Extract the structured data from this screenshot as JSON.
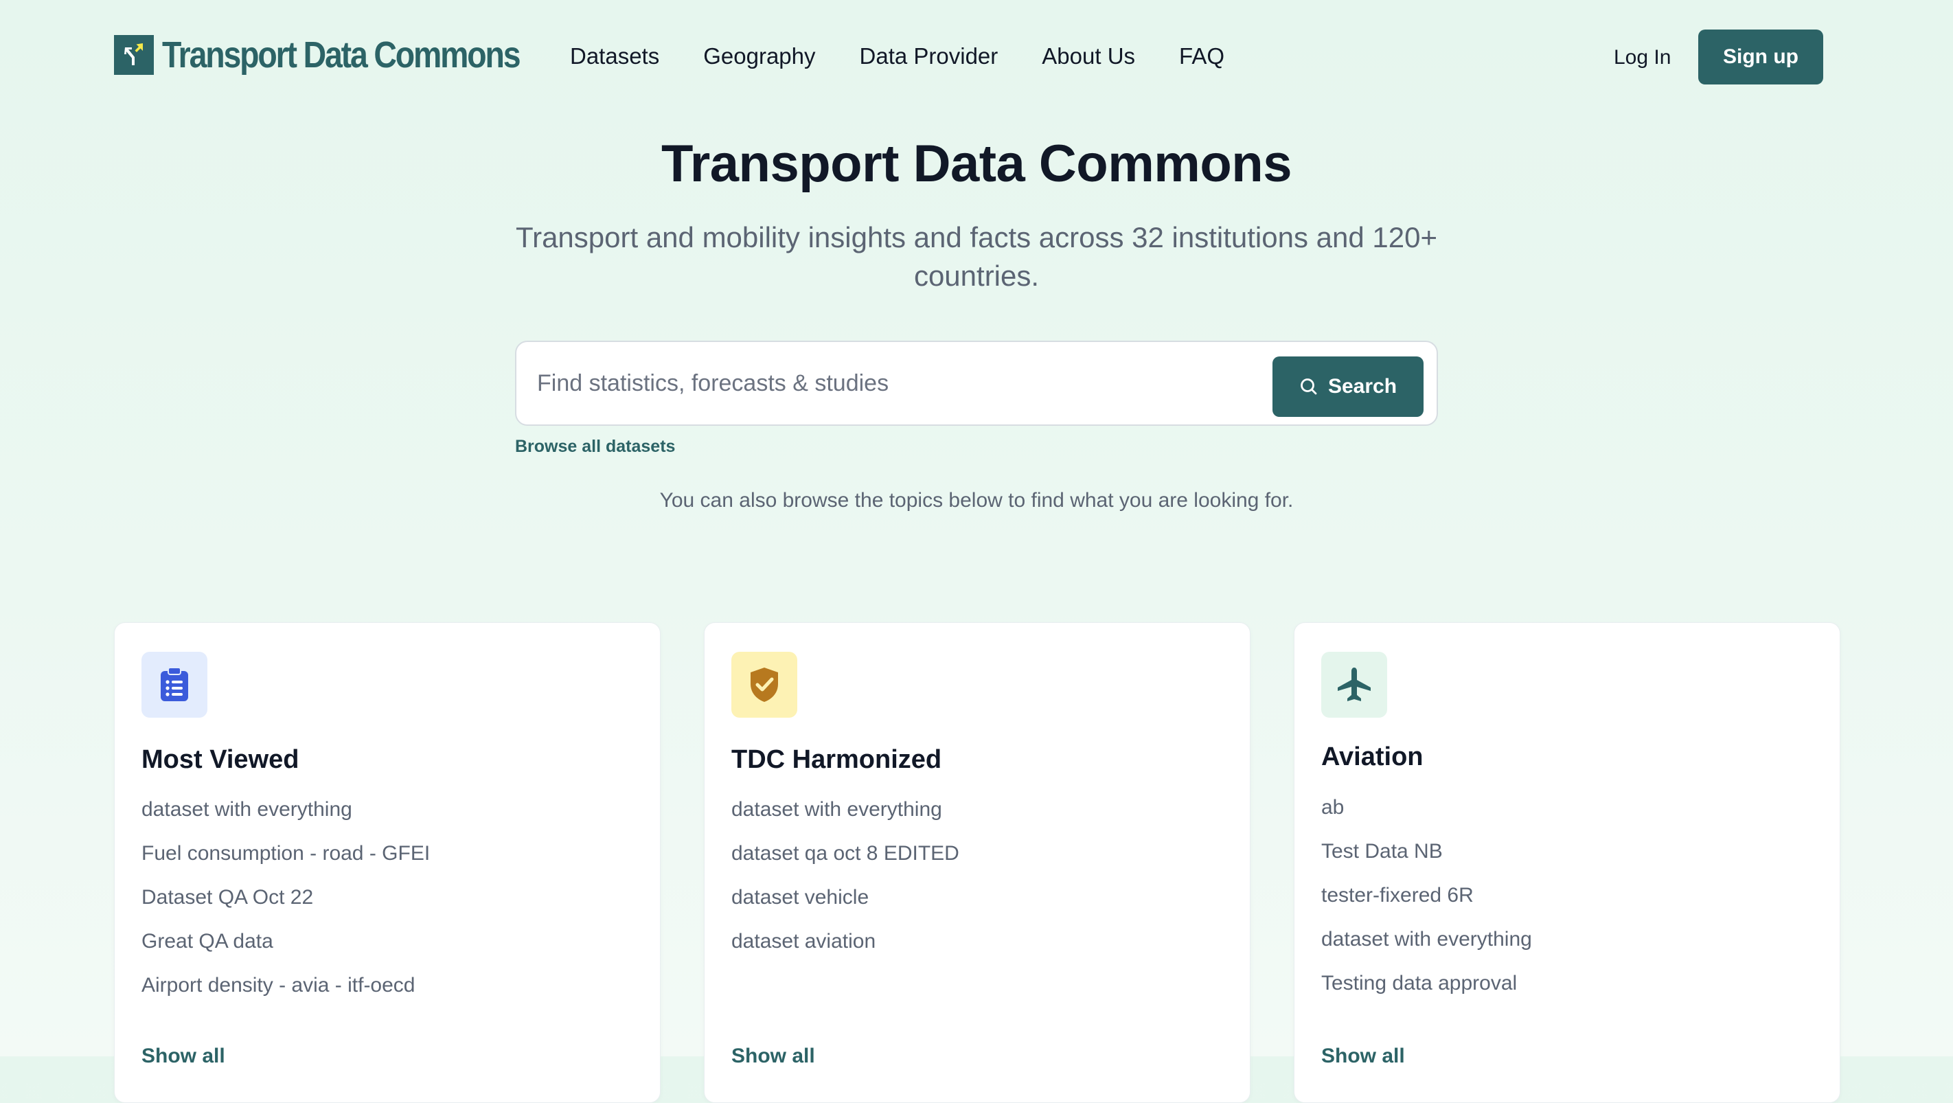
{
  "brand": {
    "name": "Transport Data Commons"
  },
  "nav": {
    "items": [
      "Datasets",
      "Geography",
      "Data Provider",
      "About Us",
      "FAQ"
    ],
    "login": "Log In",
    "signup": "Sign up"
  },
  "hero": {
    "title": "Transport Data Commons",
    "subtitle": "Transport and mobility insights and facts across 32 institutions and 120+ countries."
  },
  "search": {
    "placeholder": "Find statistics, forecasts & studies",
    "value": "",
    "button": "Search",
    "browse_all": "Browse all datasets",
    "hint": "You can also browse the topics below to find what you are looking for."
  },
  "cards": [
    {
      "title": "Most Viewed",
      "icon": "clipboard-list-icon",
      "icon_color": "#3b5bdb",
      "icon_bg": "#e3ecfd",
      "items": [
        "dataset with everything",
        "Fuel consumption - road - GFEI",
        "Dataset QA Oct 22",
        "Great QA data",
        "Airport density - avia - itf-oecd"
      ],
      "show_all": "Show all"
    },
    {
      "title": "TDC Harmonized",
      "icon": "shield-check-icon",
      "icon_color": "#b7791f",
      "icon_bg": "#fdf2b4",
      "items": [
        "dataset with everything",
        "dataset qa oct 8 EDITED",
        "dataset vehicle",
        "dataset aviation"
      ],
      "show_all": "Show all"
    },
    {
      "title": "Aviation",
      "icon": "airplane-icon",
      "icon_color": "#2c6366",
      "icon_bg": "#e4f5ec",
      "items": [
        "ab",
        "Test Data NB",
        "tester-fixered 6R",
        "dataset with everything",
        "Testing data approval"
      ],
      "show_all": "Show all"
    }
  ],
  "colors": {
    "accent": "#2c6366",
    "text": "#111827",
    "muted": "#5b6473"
  }
}
